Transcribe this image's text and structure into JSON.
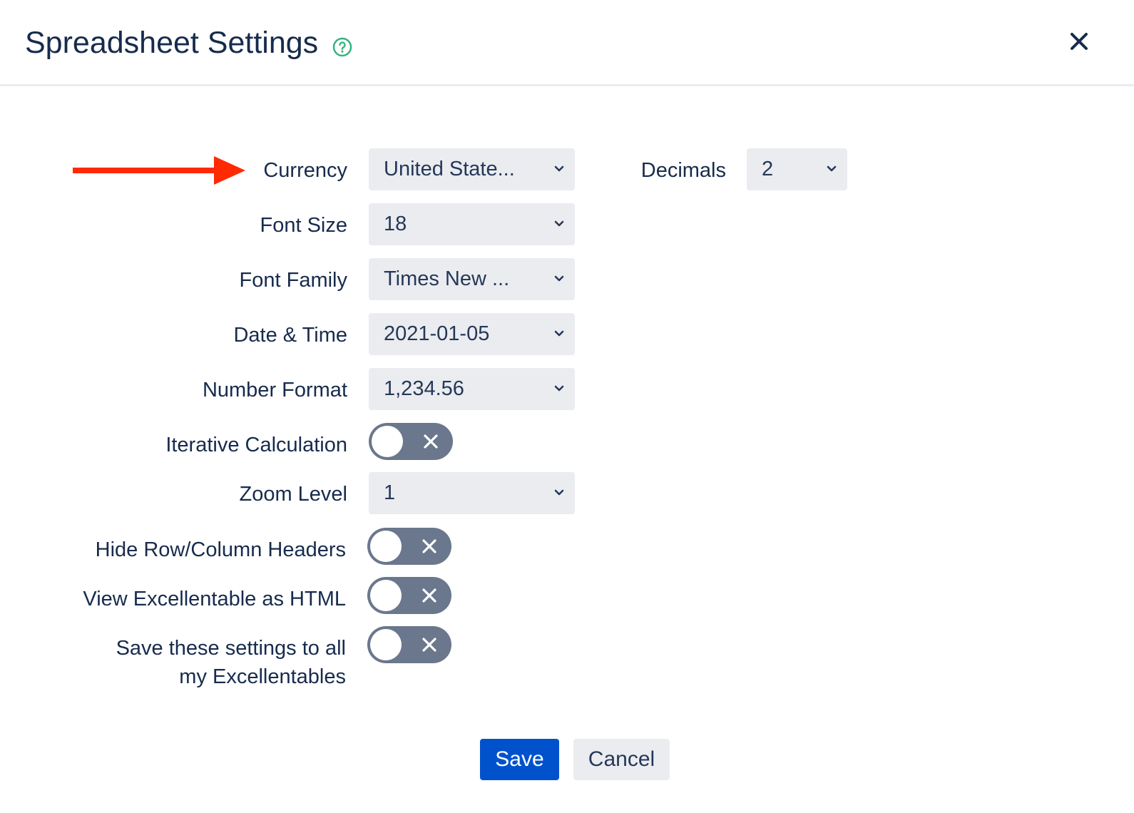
{
  "dialog": {
    "title": "Spreadsheet Settings",
    "help_icon": "question-circle-icon",
    "close_icon": "close-icon"
  },
  "annotation": {
    "arrow_color": "#ff2a00",
    "points_to": "Currency"
  },
  "fields": {
    "currency": {
      "label": "Currency",
      "value": "United State..."
    },
    "decimals": {
      "label": "Decimals",
      "value": "2"
    },
    "font_size": {
      "label": "Font Size",
      "value": "18"
    },
    "font_family": {
      "label": "Font Family",
      "value": "Times New ..."
    },
    "date_time": {
      "label": "Date & Time",
      "value": "2021-01-05"
    },
    "number_format": {
      "label": "Number Format",
      "value": "1,234.56"
    },
    "iterative_calculation": {
      "label": "Iterative Calculation",
      "enabled": false
    },
    "zoom_level": {
      "label": "Zoom Level",
      "value": "1"
    },
    "hide_headers": {
      "label": "Hide Row/Column Headers",
      "enabled": false
    },
    "view_html": {
      "label": "View Excellentable as HTML",
      "enabled": false
    },
    "save_all": {
      "label_line1": "Save these settings to all",
      "label_line2": "my Excellentables",
      "enabled": false
    }
  },
  "buttons": {
    "save": "Save",
    "cancel": "Cancel"
  },
  "colors": {
    "primary": "#0052cc",
    "text": "#172b4d",
    "select_bg": "#ebecf0",
    "toggle_off": "#6b778c",
    "help_green": "#36b37e"
  }
}
